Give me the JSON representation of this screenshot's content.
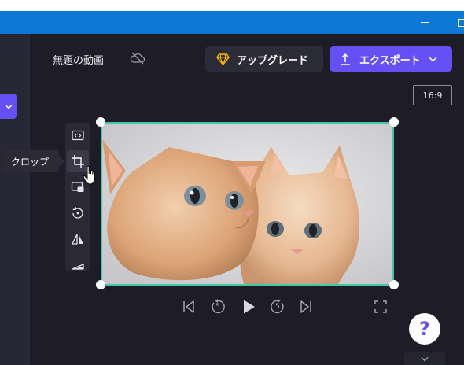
{
  "window": {
    "minimize_icon": "minimize-icon",
    "maximize_icon": "maximize-icon"
  },
  "header": {
    "project_title": "無題の動画",
    "cloud_status_icon": "cloud-off-icon",
    "upgrade_label": "アップグレード",
    "export_label": "エクスポート"
  },
  "preview": {
    "aspect_ratio": "16:9",
    "image_alt": "two orange kittens"
  },
  "toolbar": {
    "tools": [
      {
        "name": "fit",
        "icon": "fit-frame-icon"
      },
      {
        "name": "crop",
        "icon": "crop-icon",
        "active": true
      },
      {
        "name": "pip",
        "icon": "picture-in-picture-icon"
      },
      {
        "name": "rotate",
        "icon": "rotate-icon"
      },
      {
        "name": "flip",
        "icon": "flip-icon"
      },
      {
        "name": "volume",
        "icon": "volume-icon"
      }
    ],
    "tooltip": "クロップ"
  },
  "playback": {
    "skip_back_label": "5",
    "skip_forward_label": "5"
  },
  "help": {
    "label": "?"
  },
  "colors": {
    "accent": "#6551f3",
    "selection": "#45c6a6",
    "background": "#1d1c27",
    "titlebar": "#0a78d4"
  }
}
